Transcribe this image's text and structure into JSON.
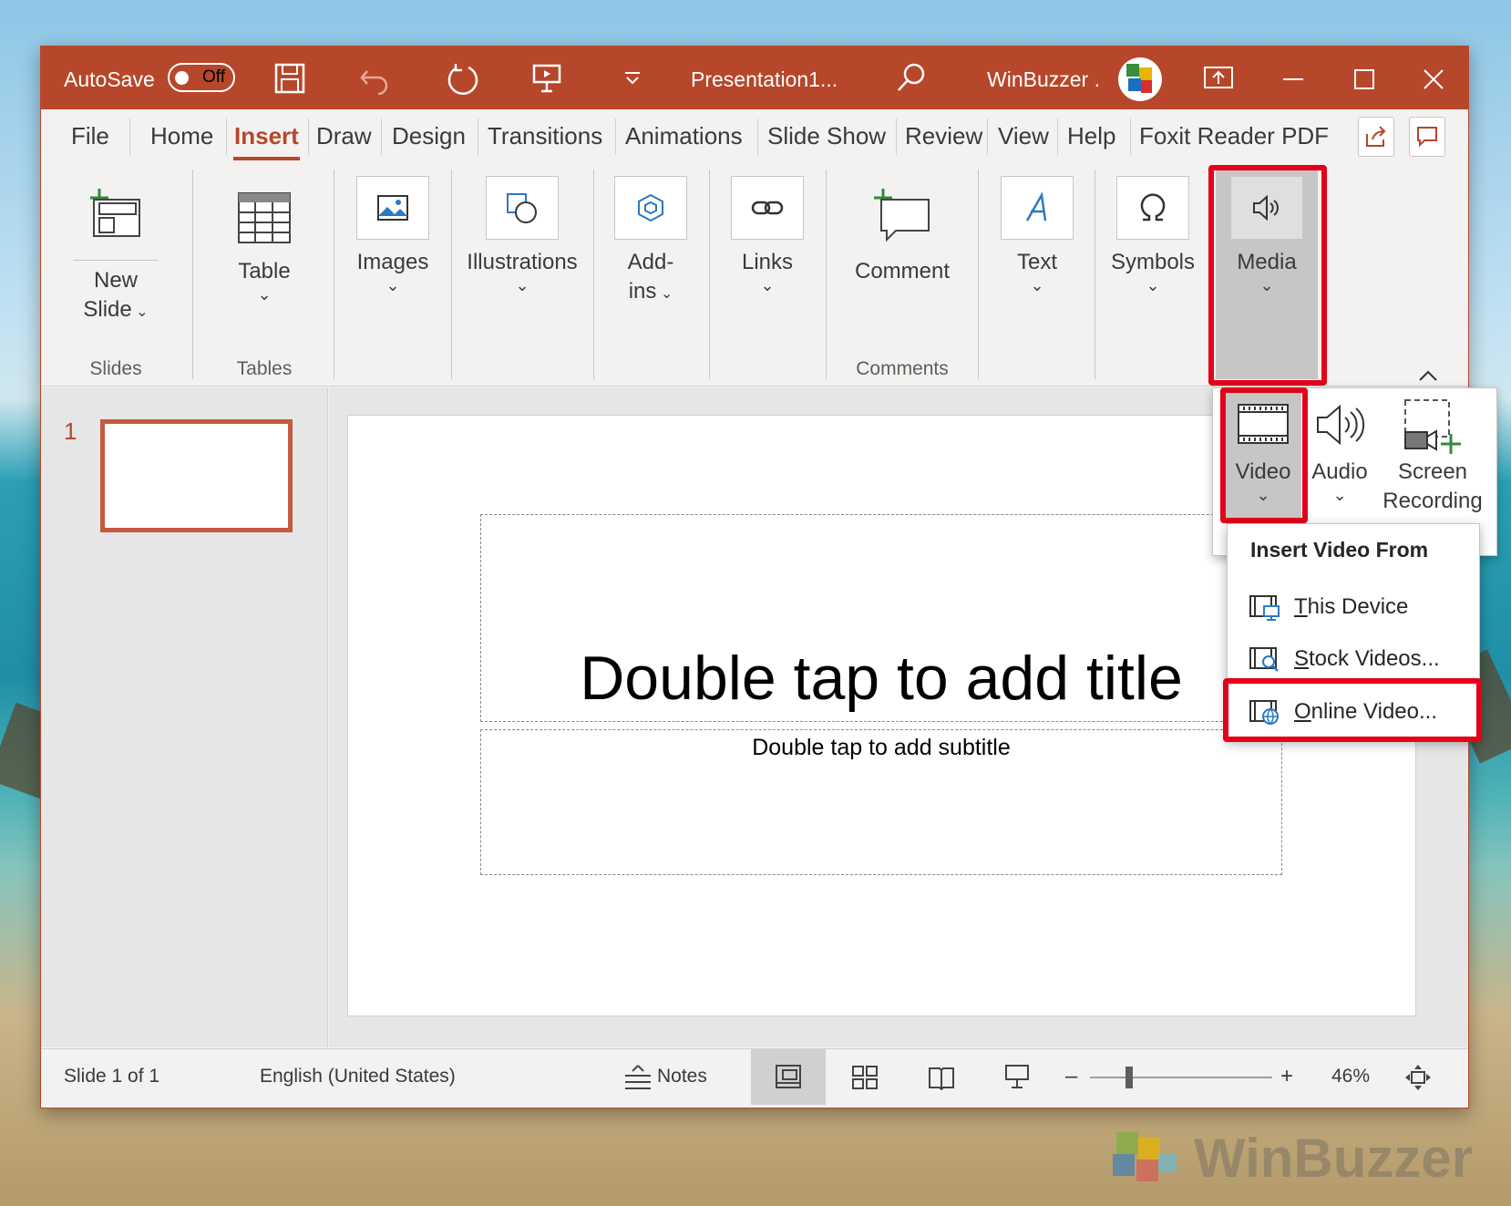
{
  "titlebar": {
    "autosave_label": "AutoSave",
    "autosave_state": "Off",
    "doc_title": "Presentation1...",
    "user_name": "WinBuzzer ."
  },
  "tabs": [
    "File",
    "Home",
    "Insert",
    "Draw",
    "Design",
    "Transitions",
    "Animations",
    "Slide Show",
    "Review",
    "View",
    "Help",
    "Foxit Reader PDF"
  ],
  "active_tab": "Insert",
  "ribbon": {
    "new_slide": [
      "New",
      "Slide"
    ],
    "table": "Table",
    "images": "Images",
    "illustrations": "Illustrations",
    "addins": [
      "Add-",
      "ins"
    ],
    "links": "Links",
    "comment": "Comment",
    "text": "Text",
    "symbols": "Symbols",
    "media": "Media",
    "groups": {
      "slides": "Slides",
      "tables": "Tables",
      "comments": "Comments"
    }
  },
  "media_panel": {
    "video": "Video",
    "audio": "Audio",
    "screen_recording": [
      "Screen",
      "Recording"
    ]
  },
  "insert_video_menu": {
    "header": "Insert Video From",
    "items": [
      {
        "label_prefix": "",
        "underlined": "T",
        "label_rest": "his Device"
      },
      {
        "label_prefix": "",
        "underlined": "S",
        "label_rest": "tock Videos..."
      },
      {
        "label_prefix": "",
        "underlined": "O",
        "label_rest": "nline Video..."
      }
    ]
  },
  "slide_panel": {
    "number": "1"
  },
  "slide": {
    "title_placeholder": "Double tap to add title",
    "subtitle_placeholder": "Double tap to add subtitle"
  },
  "statusbar": {
    "slide_count": "Slide 1 of 1",
    "language": "English (United States)",
    "notes": "Notes",
    "zoom": "46%"
  },
  "watermark": "WinBuzzer",
  "colors": {
    "accent": "#b7472a",
    "highlight": "#e5001a",
    "link": "#0f6cbd"
  }
}
